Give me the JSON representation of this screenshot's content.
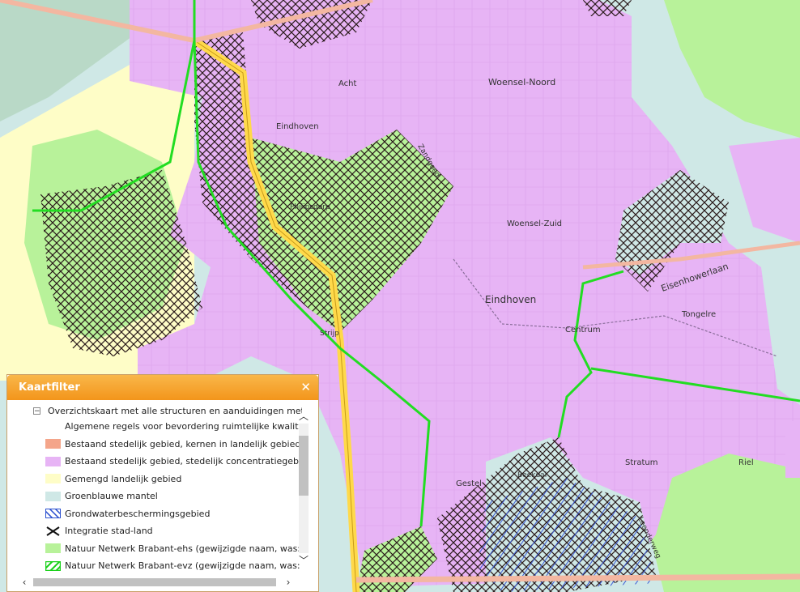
{
  "map": {
    "labels": {
      "acht": "Acht",
      "woensel_noord": "Woensel-Noord",
      "eindhoven_nw": "Eindhoven",
      "woensel_zuid": "Woensel-Zuid",
      "eindhoven_center": "Eindhoven",
      "centrum": "Centrum",
      "tongelre": "Tongelre",
      "eisenhowerlaan": "Eisenhowerlaan",
      "stratum": "Stratum",
      "gestel": "Gestel",
      "riel": "Riel",
      "strijp": "Strijp",
      "philipsdorp": "Philipsdorp",
      "beekdal": "Beekdal",
      "leenderweg": "Leenderweg",
      "zandgoed": "Zandgoed"
    }
  },
  "panel": {
    "title": "Kaartfilter",
    "close_icon": "close-icon",
    "root_label": "Overzichtskaart met alle structuren en aanduidingen met v",
    "collapse_symbol": "⊟",
    "legend": [
      {
        "label": "Algemene regels voor bevordering ruimtelijke kwaliteit",
        "swatch": "none"
      },
      {
        "label": "Bestaand stedelijk gebied, kernen in landelijk gebied",
        "swatch": "solid",
        "color": "#f4a58a"
      },
      {
        "label": "Bestaand stedelijk gebied, stedelijk concentratiegebied",
        "swatch": "solid",
        "color": "#e7b4f5"
      },
      {
        "label": "Gemengd landelijk gebied",
        "swatch": "solid",
        "color": "#fefdc7"
      },
      {
        "label": "Groenblauwe mantel",
        "swatch": "solid",
        "color": "#cfe8e6"
      },
      {
        "label": "Grondwaterbeschermingsgebied",
        "swatch": "blue-hatch",
        "color": "#2a4fcf"
      },
      {
        "label": "Integratie stad-land",
        "swatch": "cross",
        "color": "#000000"
      },
      {
        "label": "Natuur Netwerk Brabant-ehs (gewijzigde naam, was: ecolo",
        "swatch": "solid",
        "color": "#b8f29a"
      },
      {
        "label": "Natuur Netwerk Brabant-evz (gewijzigde naam, was: ecolo",
        "swatch": "green-hatch",
        "color": "#18d018"
      }
    ]
  },
  "colors": {
    "urban": "#e7b4f5",
    "rural": "#fefdc7",
    "nature": "#b8f29a",
    "mantel": "#cfe8e6",
    "highway": "#ffd94a",
    "ecolink": "#22dd22",
    "panel_header": "#f4a024"
  }
}
